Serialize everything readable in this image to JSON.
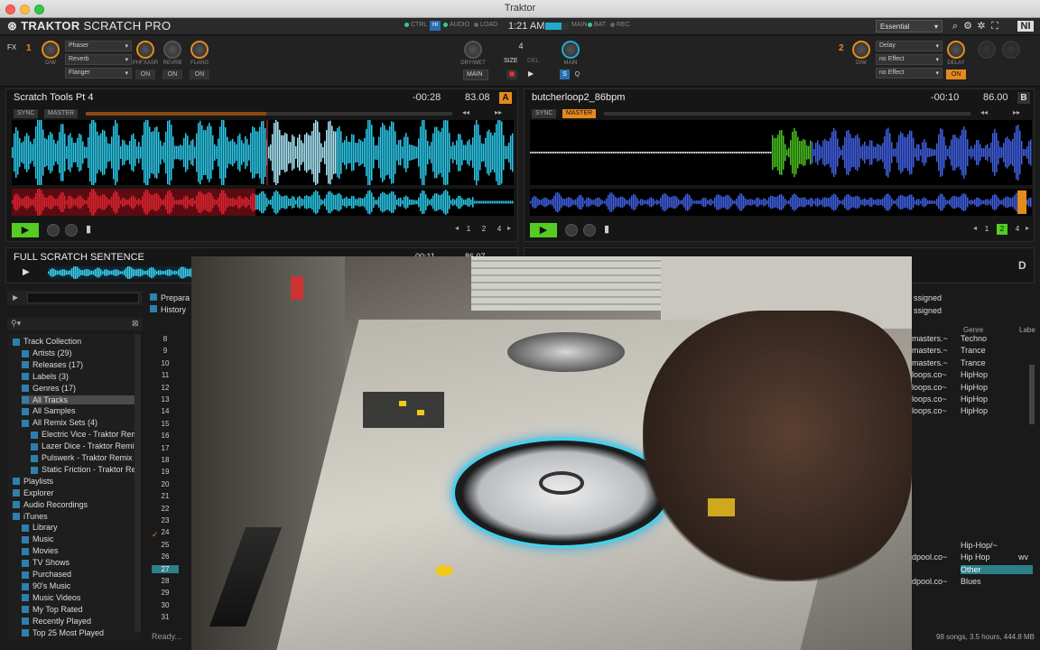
{
  "window": {
    "title": "Traktor"
  },
  "header": {
    "logo_bold": "TRAKTOR",
    "logo_rest": " SCRATCH PRO",
    "ctrl": "CTRL",
    "audio": "AUDIO",
    "load": "LOAD",
    "clock": "1:21 AM",
    "main": "MAIN",
    "bat": "BAT",
    "rec": "REC",
    "layout": "Essential",
    "hi_badge": "HI"
  },
  "fx_left": {
    "label": "FX",
    "unit": "1",
    "dw": "D/W",
    "effects": [
      "Phaser",
      "Reverb",
      "Flanger"
    ],
    "knob_labels": [
      "PHFXASR",
      "REVRB",
      "FLANG"
    ],
    "on": [
      "ON",
      "ON",
      "ON"
    ]
  },
  "fx_center": {
    "drywet": "DRY/WET",
    "size_val": "4",
    "size": "SIZE",
    "del": "DEL",
    "main_sel": "MAIN",
    "main": "MAIN",
    "s": "S",
    "q": "Q"
  },
  "fx_right": {
    "unit": "2",
    "dw": "D/W",
    "effects": [
      "Delay",
      "no Effect",
      "no Effect"
    ],
    "knob_label": "DELAY",
    "on": "ON"
  },
  "deck_a": {
    "title": "Scratch Tools Pt 4",
    "time": "-00:28",
    "bpm": "83.08",
    "letter": "A",
    "sync": "SYNC",
    "master": "MASTER",
    "loops": [
      "1",
      "2",
      "4"
    ]
  },
  "deck_b": {
    "title": "butcherloop2_86bpm",
    "time": "-00:10",
    "bpm": "86.00",
    "letter": "B",
    "sync": "SYNC",
    "master": "MASTER",
    "loops": [
      "1",
      "2",
      "4"
    ]
  },
  "deck_c": {
    "title": "FULL SCRATCH SENTENCE",
    "time": "-00:11",
    "bpm": "86.07"
  },
  "deck_d": {
    "letter": "D"
  },
  "browser": {
    "favorites": [
      "Prepara",
      "History"
    ],
    "tree": [
      {
        "label": "Track Collection",
        "indent": 0
      },
      {
        "label": "Artists (29)",
        "indent": 1
      },
      {
        "label": "Releases (17)",
        "indent": 1
      },
      {
        "label": "Labels (3)",
        "indent": 1
      },
      {
        "label": "Genres (17)",
        "indent": 1
      },
      {
        "label": "All Tracks",
        "indent": 1,
        "selected": true
      },
      {
        "label": "All Samples",
        "indent": 1
      },
      {
        "label": "All Remix Sets (4)",
        "indent": 1
      },
      {
        "label": "Electric Vice - Traktor Rem",
        "indent": 2
      },
      {
        "label": "Lazer Dice - Traktor Remix",
        "indent": 2
      },
      {
        "label": "Pulswerk - Traktor Remix S",
        "indent": 2
      },
      {
        "label": "Static Friction - Traktor Re",
        "indent": 2
      },
      {
        "label": "Playlists",
        "indent": 0
      },
      {
        "label": "Explorer",
        "indent": 0
      },
      {
        "label": "Audio Recordings",
        "indent": 0
      },
      {
        "label": "iTunes",
        "indent": 0
      },
      {
        "label": "Library",
        "indent": 1
      },
      {
        "label": "Music",
        "indent": 1
      },
      {
        "label": "Movies",
        "indent": 1
      },
      {
        "label": "TV Shows",
        "indent": 1
      },
      {
        "label": "Purchased",
        "indent": 1
      },
      {
        "label": "90's Music",
        "indent": 1
      },
      {
        "label": "Music Videos",
        "indent": 1
      },
      {
        "label": "My Top Rated",
        "indent": 1
      },
      {
        "label": "Recently Played",
        "indent": 1
      },
      {
        "label": "Top 25 Most Played",
        "indent": 1
      }
    ],
    "row_numbers": [
      "8",
      "9",
      "10",
      "11",
      "12",
      "13",
      "14",
      "15",
      "16",
      "17",
      "18",
      "19",
      "20",
      "21",
      "22",
      "23",
      "24",
      "25",
      "26",
      "27",
      "28",
      "29",
      "30",
      "31"
    ],
    "assigned": [
      "ssigned",
      "ssigned"
    ],
    "col_genre": "Genre",
    "col_label": "Labe",
    "right_rows": [
      {
        "src": "masters.~",
        "genre": "Techno"
      },
      {
        "src": "masters.~",
        "genre": "Trance"
      },
      {
        "src": "masters.~",
        "genre": "Trance"
      },
      {
        "src": "loops.co~",
        "genre": "HipHop"
      },
      {
        "src": "loops.co~",
        "genre": "HipHop"
      },
      {
        "src": "loops.co~",
        "genre": "HipHop"
      },
      {
        "src": "loops.co~",
        "genre": "HipHop"
      }
    ],
    "lower_rows": [
      {
        "src": "",
        "genre": "Hip-Hop/~"
      },
      {
        "src": "dpool.co~",
        "genre": "Hip Hop",
        "label": "wv"
      },
      {
        "src": "",
        "genre": "Other"
      },
      {
        "src": "dpool.co~",
        "genre": "Blues"
      }
    ],
    "status_left": "Ready...",
    "status_right": "98 songs, 3.5 hours, 444.8 MB"
  },
  "colors": {
    "accent_orange": "#e58a1d",
    "play_green": "#55cc22",
    "wave_cyan": "#33d4ee",
    "wave_red": "#d8232e",
    "deck_b_blue": "#4060e0"
  }
}
